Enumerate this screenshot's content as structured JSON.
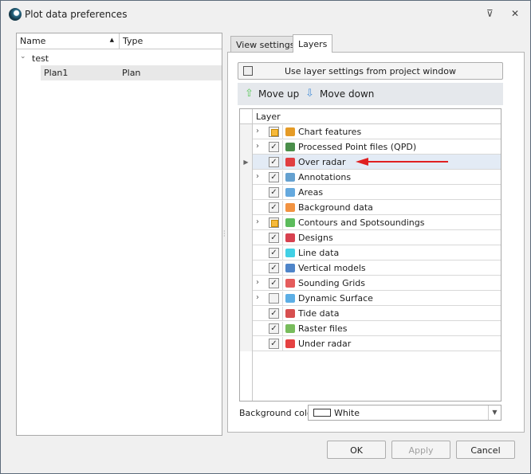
{
  "window": {
    "title": "Plot data preferences",
    "pin_icon": "pin-icon",
    "close_icon": "close-icon"
  },
  "tree": {
    "columns": [
      "Name",
      "Type"
    ],
    "root": "test",
    "items": [
      {
        "name": "Plan1",
        "type": "Plan"
      }
    ]
  },
  "tabs": [
    "View settings",
    "Layers"
  ],
  "layers": {
    "use_project_label": "Use layer settings from project window",
    "move_up": "Move up",
    "move_down": "Move down",
    "column": "Layer",
    "rows": [
      {
        "label": "Chart features",
        "expandable": true,
        "check": "partial",
        "icon": "north-arrow-icon",
        "color": "#e08a00"
      },
      {
        "label": "Processed Point files (QPD)",
        "expandable": true,
        "check": "checked",
        "icon": "qpd-icon",
        "color": "#2a7a2a"
      },
      {
        "label": "Over radar",
        "expandable": false,
        "check": "checked",
        "icon": "radar-icon",
        "color": "#e02020",
        "selected": true
      },
      {
        "label": "Annotations",
        "expandable": true,
        "check": "checked",
        "icon": "annotation-icon",
        "color": "#4a90c8"
      },
      {
        "label": "Areas",
        "expandable": false,
        "check": "checked",
        "icon": "area-icon",
        "color": "#4a9ad8"
      },
      {
        "label": "Background data",
        "expandable": false,
        "check": "checked",
        "icon": "background-data-icon",
        "color": "#f08020"
      },
      {
        "label": "Contours and Spotsoundings",
        "expandable": true,
        "check": "partial",
        "icon": "contours-icon",
        "color": "#40b040"
      },
      {
        "label": "Designs",
        "expandable": false,
        "check": "checked",
        "icon": "designs-icon",
        "color": "#d02030"
      },
      {
        "label": "Line data",
        "expandable": false,
        "check": "checked",
        "icon": "line-data-icon",
        "color": "#20c8e0"
      },
      {
        "label": "Vertical models",
        "expandable": false,
        "check": "checked",
        "icon": "vertical-models-icon",
        "color": "#3070c0"
      },
      {
        "label": "Sounding Grids",
        "expandable": true,
        "check": "checked",
        "icon": "sounding-grid-icon",
        "color": "#e04040"
      },
      {
        "label": "Dynamic Surface",
        "expandable": true,
        "check": "unchecked",
        "icon": "dynamic-surface-icon",
        "color": "#40a0e0"
      },
      {
        "label": "Tide data",
        "expandable": false,
        "check": "checked",
        "icon": "tide-icon",
        "color": "#d03030"
      },
      {
        "label": "Raster files",
        "expandable": false,
        "check": "checked",
        "icon": "raster-icon",
        "color": "#60b040"
      },
      {
        "label": "Under radar",
        "expandable": false,
        "check": "checked",
        "icon": "radar-icon",
        "color": "#e02020"
      }
    ],
    "background_label": "Background color",
    "background_value": "White"
  },
  "buttons": {
    "ok": "OK",
    "apply": "Apply",
    "cancel": "Cancel"
  }
}
